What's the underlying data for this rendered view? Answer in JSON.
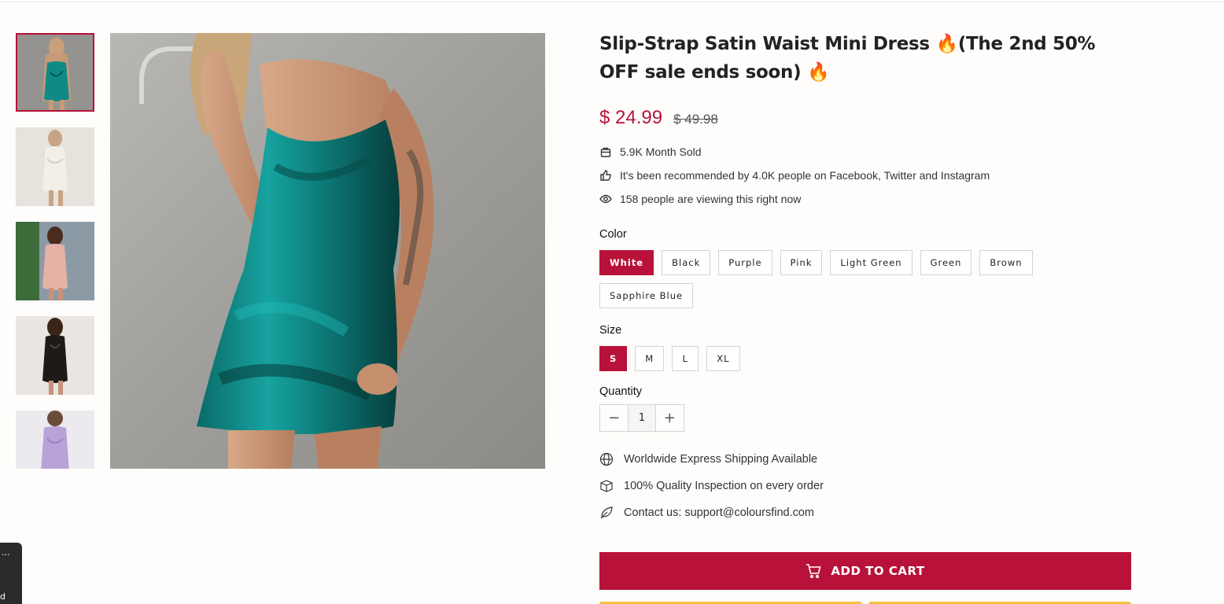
{
  "product": {
    "title": "Slip-Strap Satin Waist Mini Dress 🔥(The 2nd 50% OFF sale ends soon) 🔥",
    "price": "$ 24.99",
    "old_price": "$ 49.98"
  },
  "stats": [
    {
      "icon": "shopping-bag-icon",
      "text": "5.9K Month Sold"
    },
    {
      "icon": "thumbs-up-icon",
      "text": "It's been recommended by 4.0K people on Facebook, Twitter and Instagram"
    },
    {
      "icon": "eye-icon",
      "text": "158 people are viewing this right now"
    }
  ],
  "color": {
    "label": "Color",
    "options": [
      "White",
      "Black",
      "Purple",
      "Pink",
      "Light Green",
      "Green",
      "Brown",
      "Sapphire Blue"
    ],
    "selected": "White"
  },
  "size": {
    "label": "Size",
    "options": [
      "S",
      "M",
      "L",
      "XL"
    ],
    "selected": "S"
  },
  "quantity": {
    "label": "Quantity",
    "value": "1",
    "minus": "−",
    "plus": "+"
  },
  "features": [
    {
      "icon": "globe-icon",
      "text": "Worldwide Express Shipping Available"
    },
    {
      "icon": "box-icon",
      "text": "100% Quality Inspection on every order"
    },
    {
      "icon": "leaf-icon",
      "text": "Contact us: support@coloursfind.com"
    }
  ],
  "cart_button": "ADD TO CART",
  "side_widget": {
    "top": "...",
    "bottom": "d"
  },
  "colors": {
    "accent": "#b8123a",
    "dress_teal": "#0f8a86",
    "yellow": "#f5c33b"
  }
}
